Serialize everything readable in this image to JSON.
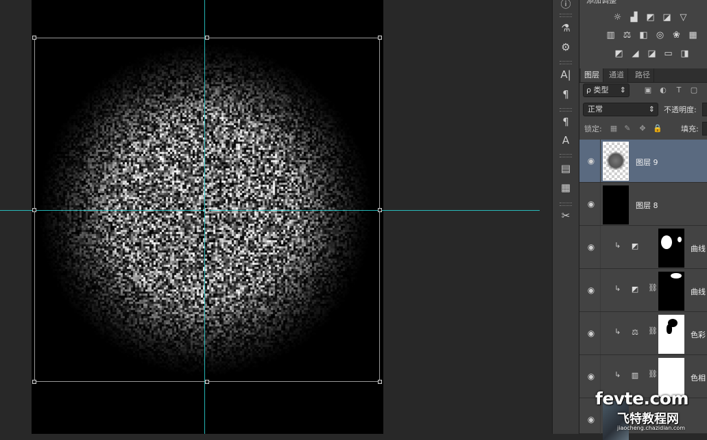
{
  "adjustments": {
    "title": "添加调整",
    "row1": [
      "sun-icon",
      "levels-icon",
      "curves-icon",
      "exposure-icon",
      "triangle-icon"
    ],
    "row2": [
      "hue-icon",
      "balance-icon",
      "bw-icon",
      "camera-icon",
      "mixer-icon",
      "grid-icon"
    ],
    "row3": [
      "invert-icon",
      "posterize-icon",
      "threshold-icon",
      "gradient-map-icon",
      "selective-color-icon"
    ]
  },
  "tabs": [
    "图层",
    "通道",
    "路径"
  ],
  "filter": {
    "label": "ρ 类型",
    "arrow": "⇕"
  },
  "blend": {
    "mode": "正常",
    "opacity_label": "不透明度:"
  },
  "lock": {
    "label": "锁定:",
    "fill_label": "填充:"
  },
  "layers": [
    {
      "name": "图层 9",
      "selected": true
    },
    {
      "name": "图层 8",
      "selected": false
    },
    {
      "name": "曲线",
      "selected": false
    },
    {
      "name": "曲线",
      "selected": false
    },
    {
      "name": "色彩",
      "selected": false
    },
    {
      "name": "色相",
      "selected": false
    },
    {
      "name": "",
      "selected": false
    }
  ],
  "watermark": {
    "brand": "fevte.com",
    "cn": "飞特教程网",
    "url": "jiaocheng.chazidian.com"
  },
  "colors": {
    "guide": "#2ad6d6",
    "selected_layer": "#5a6a80",
    "panel": "#434343"
  }
}
